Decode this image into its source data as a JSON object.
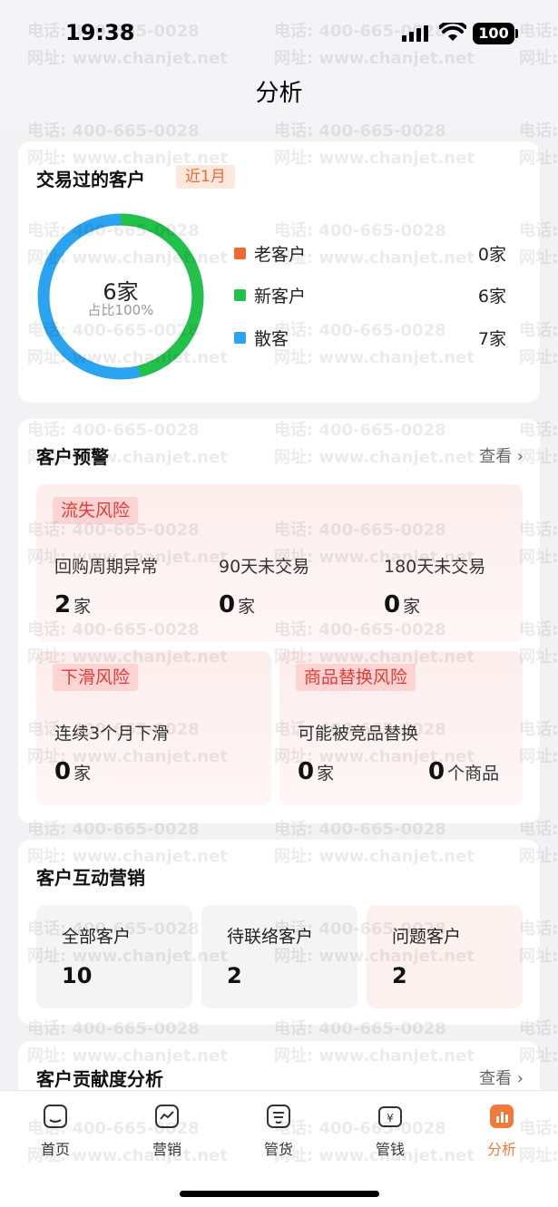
{
  "status": {
    "time": "19:38",
    "battery": "100"
  },
  "nav": {
    "title": "分析"
  },
  "watermark": {
    "phone": "电话: 400-665-0028",
    "site": "网址: www.chanjet.net"
  },
  "traded": {
    "title": "交易过的客户",
    "period_tag": "近1月",
    "center_value": "6家",
    "center_sub": "占比100%",
    "legend": [
      {
        "name": "老客户",
        "value": "0家",
        "color": "#ed6b33"
      },
      {
        "name": "新客户",
        "value": "6家",
        "color": "#22c14a"
      },
      {
        "name": "散客",
        "value": "7家",
        "color": "#2aa4f0"
      }
    ]
  },
  "warning": {
    "title": "客户预警",
    "view": "查看",
    "churn": {
      "tag": "流失风险",
      "items": [
        {
          "label": "回购周期异常",
          "value": "2",
          "unit": "家"
        },
        {
          "label": "90天未交易",
          "value": "0",
          "unit": "家"
        },
        {
          "label": "180天未交易",
          "value": "0",
          "unit": "家"
        }
      ]
    },
    "decline": {
      "tag": "下滑风险",
      "label": "连续3个月下滑",
      "value": "0",
      "unit": "家"
    },
    "replace": {
      "tag": "商品替换风险",
      "label": "可能被竞品替换",
      "value": "0",
      "unit": "家",
      "value2": "0",
      "unit2": "个商品"
    }
  },
  "interaction": {
    "title": "客户互动营销",
    "items": [
      {
        "label": "全部客户",
        "value": "10"
      },
      {
        "label": "待联络客户",
        "value": "2"
      },
      {
        "label": "问题客户",
        "value": "2"
      }
    ]
  },
  "contribution": {
    "title": "客户贡献度分析",
    "view": "查看"
  },
  "tabs": [
    {
      "label": "首页",
      "icon": "home-icon"
    },
    {
      "label": "营销",
      "icon": "marketing-icon"
    },
    {
      "label": "管货",
      "icon": "goods-icon"
    },
    {
      "label": "管钱",
      "icon": "wallet-icon"
    },
    {
      "label": "分析",
      "icon": "analysis-icon"
    }
  ]
}
